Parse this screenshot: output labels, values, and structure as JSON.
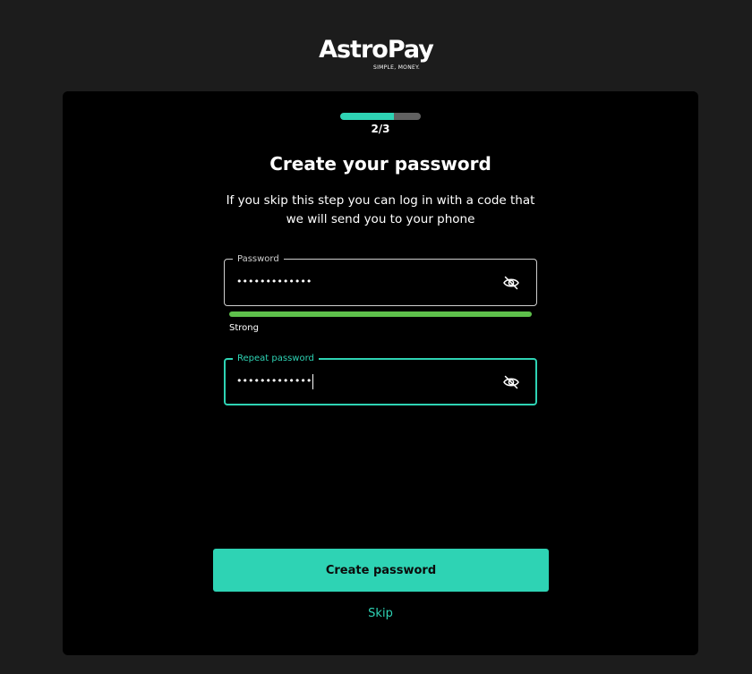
{
  "brand": {
    "name": "AstroPay",
    "tagline": "SIMPLE, MONEY.",
    "accent_color": "#2ed3b4",
    "strength_color": "#5ec04b"
  },
  "progress": {
    "label": "2/3",
    "fraction": 0.667
  },
  "title": "Create your password",
  "subtitle": "If you skip this step you can log in with a code that we will send you to your phone",
  "password_field": {
    "label": "Password",
    "value": "•••••••••••••",
    "toggle_icon": "eye-off-icon"
  },
  "strength": {
    "label": "Strong",
    "fraction": 1.0
  },
  "repeat_field": {
    "label": "Repeat password",
    "value": "•••••••••••••",
    "toggle_icon": "eye-off-icon"
  },
  "actions": {
    "primary_label": "Create password",
    "skip_label": "Skip"
  }
}
